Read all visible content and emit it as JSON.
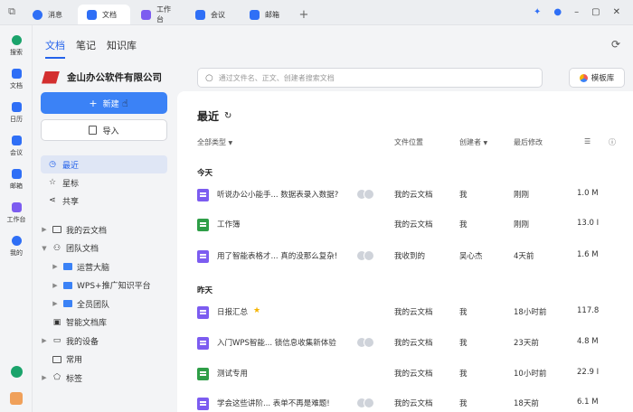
{
  "titlebar": {
    "tabs": [
      {
        "label": "消息",
        "color": "#2f6ff6"
      },
      {
        "label": "文档",
        "color": "#2f6ff6",
        "active": true
      },
      {
        "label": "工作台",
        "color": "#7c5cf0"
      },
      {
        "label": "会议",
        "color": "#2f6ff6"
      },
      {
        "label": "邮箱",
        "color": "#2f6ff6"
      }
    ]
  },
  "rail": {
    "items": [
      {
        "label": "搜索",
        "icon": "search-icon",
        "color": "#1aa36b"
      },
      {
        "label": "文档",
        "icon": "document-icon",
        "color": "#2f6ff6"
      },
      {
        "label": "日历",
        "icon": "calendar-icon",
        "color": "#2f6ff6"
      },
      {
        "label": "会议",
        "icon": "meeting-icon",
        "color": "#2f6ff6"
      },
      {
        "label": "邮箱",
        "icon": "mail-icon",
        "color": "#2f6ff6"
      },
      {
        "label": "工作台",
        "icon": "workbench-icon",
        "color": "#7c5cf0"
      },
      {
        "label": "我的",
        "icon": "profile-icon",
        "color": "#2f6ff6"
      }
    ]
  },
  "sidebar": {
    "tabs": [
      "文档",
      "笔记",
      "知识库"
    ],
    "org_name": "金山办公软件有限公司",
    "new_label": "新建",
    "import_label": "导入",
    "nav": [
      "最近",
      "星标",
      "共享"
    ],
    "tree": [
      {
        "label": "我的云文档",
        "level": 0,
        "caret": true,
        "icon": "folder-outline"
      },
      {
        "label": "团队文档",
        "level": 0,
        "caret": true,
        "open": true,
        "icon": "team-icon"
      },
      {
        "label": "运营大脑",
        "level": 1,
        "caret": true,
        "icon": "folder"
      },
      {
        "label": "WPS+推广知识平台",
        "level": 1,
        "caret": true,
        "icon": "folder"
      },
      {
        "label": "全员团队",
        "level": 1,
        "caret": true,
        "icon": "folder"
      },
      {
        "label": "智能文档库",
        "level": 0,
        "caret": false,
        "icon": "library-icon"
      },
      {
        "label": "我的设备",
        "level": 0,
        "caret": true,
        "icon": "device-icon"
      },
      {
        "label": "常用",
        "level": 0,
        "caret": false,
        "icon": "folder-outline"
      },
      {
        "label": "标签",
        "level": 0,
        "caret": true,
        "icon": "tag-icon"
      }
    ]
  },
  "main": {
    "search_placeholder": "通过文件名、正文、创建者搜索文档",
    "template_label": "模板库",
    "title": "最近",
    "headers": {
      "type": "全部类型",
      "location": "文件位置",
      "creator": "创建者",
      "modified": "最后修改"
    },
    "groups": [
      {
        "label": "今天",
        "rows": [
          {
            "type": "doc",
            "name": "听说办公小能手... 数据表录入数据?",
            "avatars": true,
            "location": "我的云文档",
            "creator": "我",
            "modified": "刚刚",
            "size": "1.0 M"
          },
          {
            "type": "sheet",
            "name": "工作簿",
            "avatars": false,
            "location": "我的云文档",
            "creator": "我",
            "modified": "刚刚",
            "size": "13.0 I"
          },
          {
            "type": "doc",
            "name": "用了智能表格才... 真的没那么复杂!",
            "avatars": true,
            "location": "我收到的",
            "creator": "吴心杰",
            "modified": "4天前",
            "size": "1.6 M"
          }
        ]
      },
      {
        "label": "昨天",
        "rows": [
          {
            "type": "doc",
            "name": "日报汇总",
            "starred": true,
            "avatars": false,
            "location": "我的云文档",
            "creator": "我",
            "modified": "18小时前",
            "size": "117.8"
          },
          {
            "type": "doc",
            "name": "入门WPS智能... 锁信息收集新体验",
            "avatars": true,
            "location": "我的云文档",
            "creator": "我",
            "modified": "23天前",
            "size": "4.8 M"
          },
          {
            "type": "sheet",
            "name": "测试专用",
            "avatars": false,
            "location": "我的云文档",
            "creator": "我",
            "modified": "10小时前",
            "size": "22.9 I"
          },
          {
            "type": "doc",
            "name": "学会这些讲阶... 表单不再是难题!",
            "avatars": true,
            "location": "我的云文档",
            "creator": "我",
            "modified": "18天前",
            "size": "6.1 M"
          }
        ]
      }
    ]
  }
}
